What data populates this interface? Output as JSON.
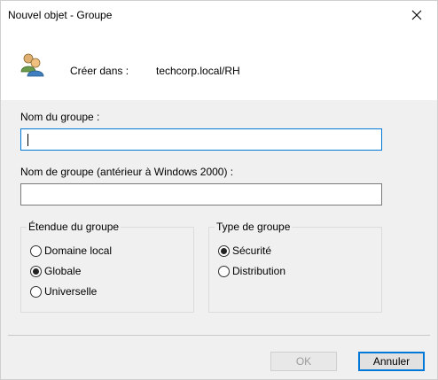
{
  "window": {
    "title": "Nouvel objet - Groupe",
    "close_glyph": "✕"
  },
  "header": {
    "icon": "group-users-icon",
    "create_in_label": "Créer dans :",
    "create_in_value": "techcorp.local/RH"
  },
  "form": {
    "group_name_label": "Nom du groupe :",
    "group_name_value": "",
    "group_name_pre2000_label": "Nom de groupe (antérieur à Windows 2000) :",
    "group_name_pre2000_value": ""
  },
  "scope": {
    "title": "Étendue du groupe",
    "options": [
      {
        "label": "Domaine local",
        "checked": false
      },
      {
        "label": "Globale",
        "checked": true
      },
      {
        "label": "Universelle",
        "checked": false
      }
    ]
  },
  "type": {
    "title": "Type de groupe",
    "options": [
      {
        "label": "Sécurité",
        "checked": true
      },
      {
        "label": "Distribution",
        "checked": false
      }
    ]
  },
  "buttons": {
    "ok_label": "OK",
    "ok_enabled": false,
    "cancel_label": "Annuler"
  },
  "colors": {
    "focus_border": "#0078d7",
    "dialog_bg": "#f0f0f0"
  }
}
